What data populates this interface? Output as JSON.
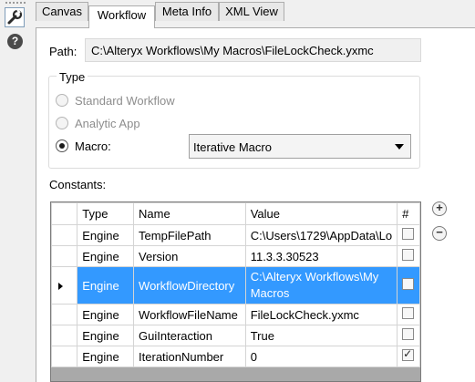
{
  "tabs": [
    {
      "label": "Canvas"
    },
    {
      "label": "Workflow"
    },
    {
      "label": "Meta Info"
    },
    {
      "label": "XML View"
    }
  ],
  "left_bar": {
    "wrench_icon": "wrench-icon",
    "help_label": "?"
  },
  "path": {
    "label": "Path:",
    "value": "C:\\Alteryx Workflows\\My Macros\\FileLockCheck.yxmc"
  },
  "type": {
    "legend": "Type",
    "options": [
      {
        "label": "Standard Workflow"
      },
      {
        "label": "Analytic App"
      },
      {
        "label": "Macro:"
      }
    ],
    "macro_select": "Iterative Macro"
  },
  "constants": {
    "label": "Constants:",
    "columns": [
      "Type",
      "Name",
      "Value",
      "#"
    ],
    "rows": [
      {
        "type": "Engine",
        "name": "TempFilePath",
        "value": "C:\\Users\\1729\\AppData\\Lo"
      },
      {
        "type": "Engine",
        "name": "Version",
        "value": "11.3.3.30523"
      },
      {
        "type": "Engine",
        "name": "WorkflowDirectory",
        "value": "C:\\Alteryx Workflows\\My Macros"
      },
      {
        "type": "Engine",
        "name": "WorkflowFileName",
        "value": "FileLockCheck.yxmc"
      },
      {
        "type": "Engine",
        "name": "GuiInteraction",
        "value": "True"
      },
      {
        "type": "Engine",
        "name": "IterationNumber",
        "value": "0"
      }
    ],
    "add_label": "+",
    "remove_label": "−"
  }
}
